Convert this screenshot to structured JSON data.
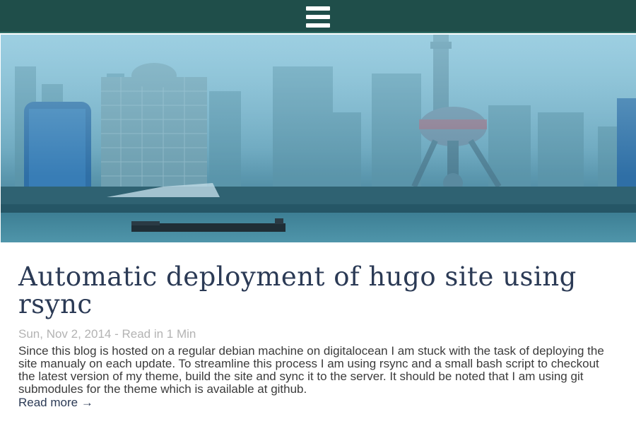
{
  "header": {
    "menu_icon": "hamburger-menu-icon",
    "background_color": "#1f4e4a"
  },
  "hero": {
    "description": "Foggy city skyline with TV tower and river"
  },
  "post": {
    "title": "Automatic deployment of hugo site using rsync",
    "date": "Sun, Nov 2, 2014",
    "meta_separator": " - ",
    "read_time": "Read in 1 Min",
    "summary": "Since this blog is hosted on a regular debian machine on digitalocean I am stuck with the task of deploying the site manualy on each update. To streamline this process I am using rsync and a small bash script to checkout the latest version of my theme, build the site and sync it to the server. It should be noted that I am using git submodules for the theme which is available at github.",
    "read_more_label": "Read more",
    "read_more_arrow": "→"
  }
}
